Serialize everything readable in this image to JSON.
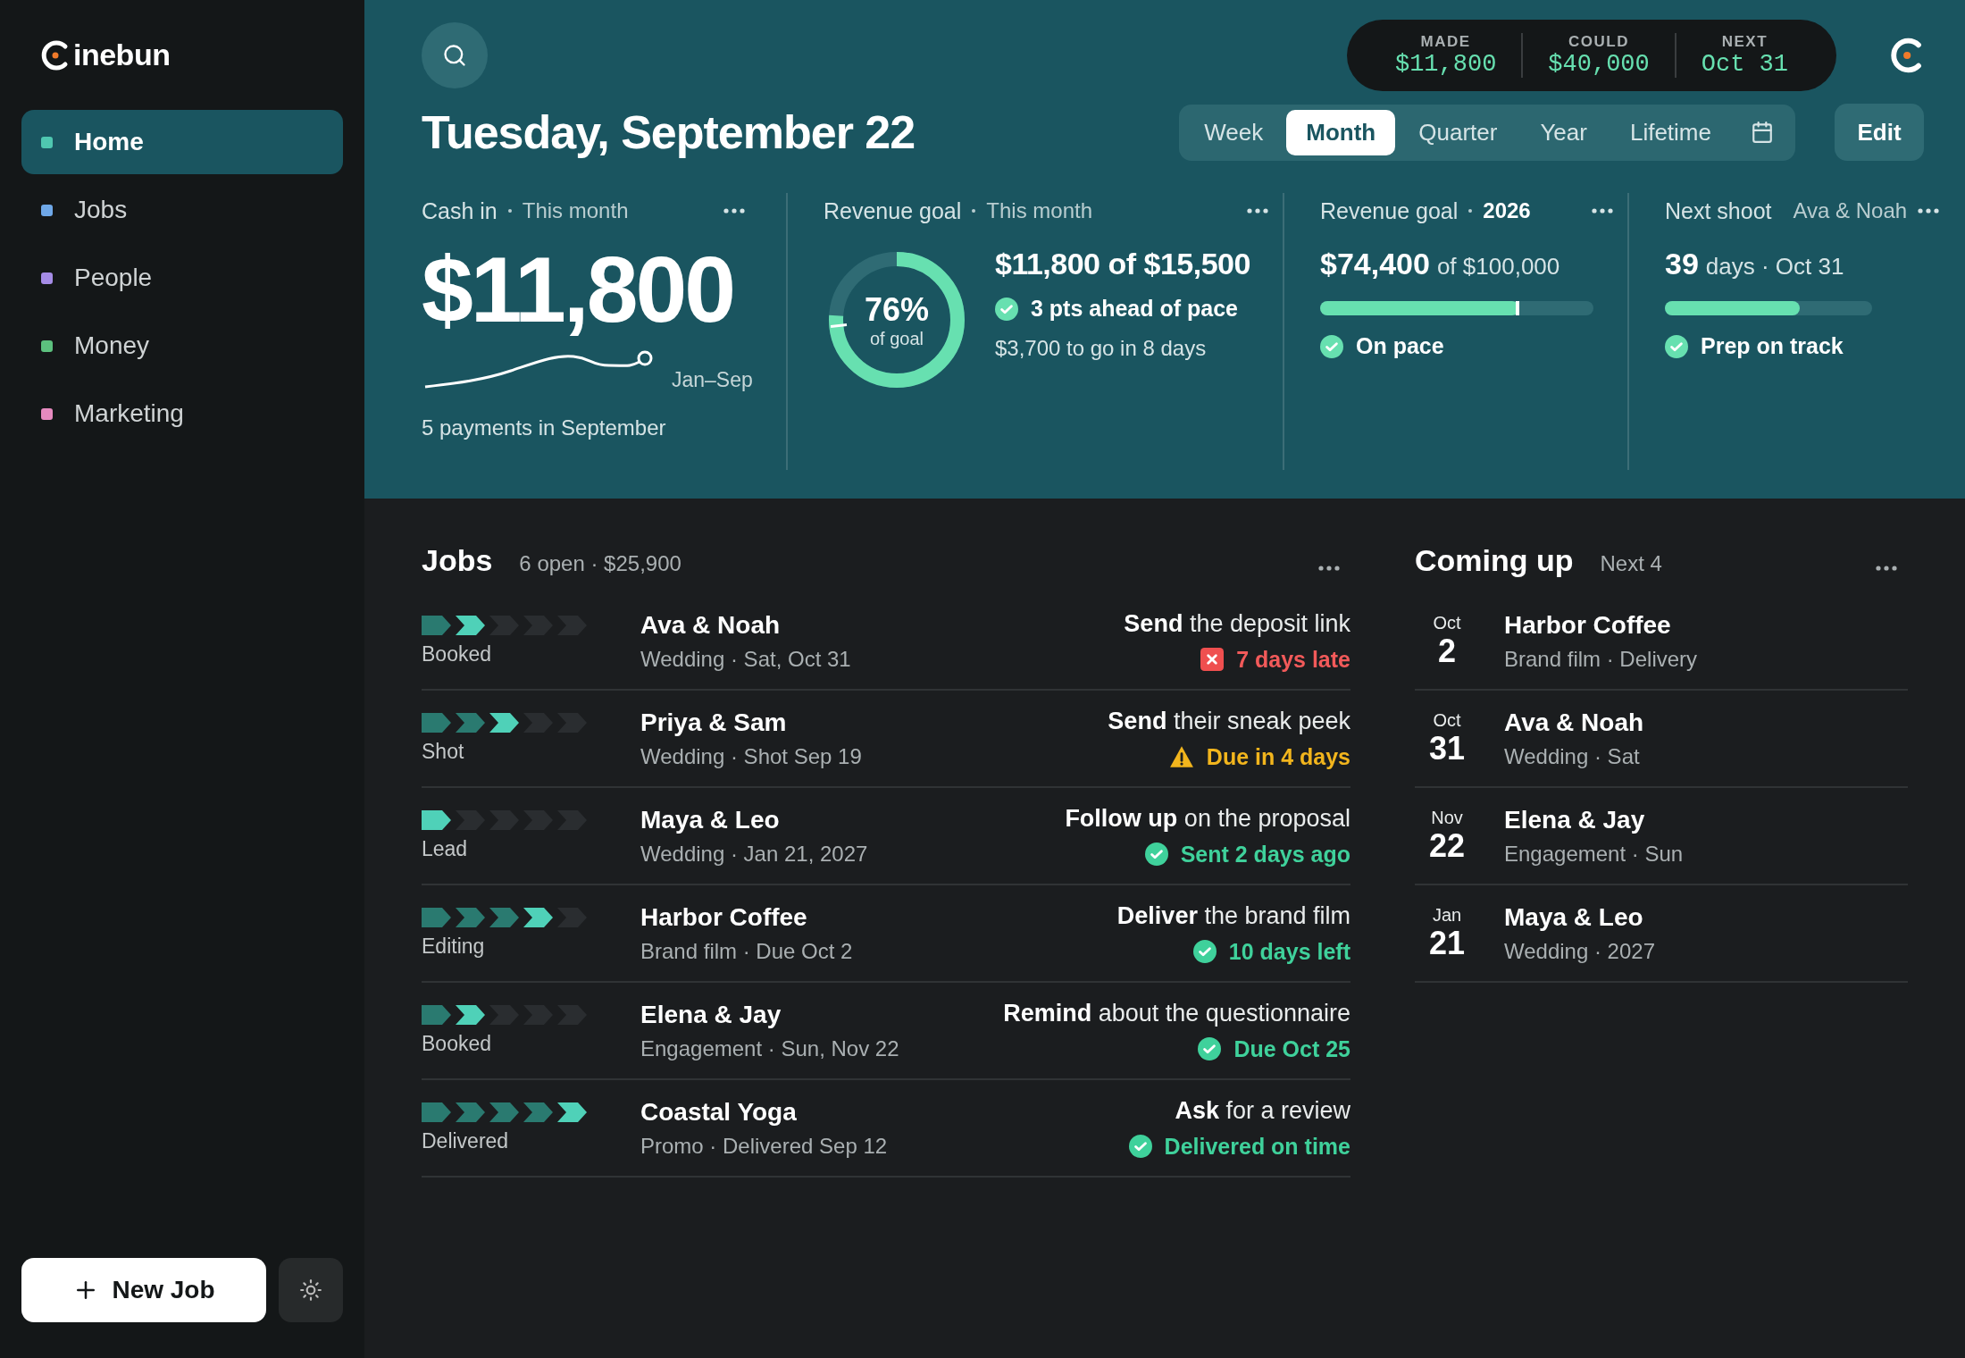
{
  "brand": {
    "name": "inebun"
  },
  "nav": [
    {
      "label": "Home",
      "selected": true,
      "color": "#4fc7b0"
    },
    {
      "label": "Jobs",
      "selected": false,
      "color": "#6fa8e8"
    },
    {
      "label": "People",
      "selected": false,
      "color": "#a58ce6"
    },
    {
      "label": "Money",
      "selected": false,
      "color": "#5cc17e"
    },
    {
      "label": "Marketing",
      "selected": false,
      "color": "#e68abf"
    }
  ],
  "new_job_button": "New Job",
  "summary": [
    {
      "label": "MADE",
      "value": "$11,800"
    },
    {
      "label": "COULD",
      "value": "$40,000"
    },
    {
      "label": "NEXT",
      "value": "Oct 31"
    }
  ],
  "title": "Tuesday, September 22",
  "ranges": [
    {
      "label": "Week",
      "selected": false
    },
    {
      "label": "Month",
      "selected": true
    },
    {
      "label": "Quarter",
      "selected": false
    },
    {
      "label": "Year",
      "selected": false
    },
    {
      "label": "Lifetime",
      "selected": false
    }
  ],
  "edit_button": "Edit",
  "cards": [
    {
      "kind": "cash",
      "label": "Cash in",
      "sub": "This month",
      "sub_strong": false,
      "amount": "$11,800",
      "caption": "Jan–Sep",
      "footer": "5 payments in September"
    },
    {
      "kind": "ring",
      "label": "Revenue goal",
      "sub": "This month",
      "sub_strong": false,
      "ring_value": "76%",
      "ring_label": "of goal",
      "headline": "$11,800 of $15,500",
      "status": "3 pts ahead of pace",
      "note": "$3,700 to go in 8 days"
    },
    {
      "kind": "bar",
      "label": "Revenue goal",
      "sub": "2026",
      "sub_strong": true,
      "value": "$74,400",
      "suffix": "of $100,000",
      "level": 0.73,
      "status": "On pace"
    },
    {
      "kind": "bar",
      "label": "Next shoot",
      "sub": "Ava & Noah",
      "sub_strong": false,
      "value": "39",
      "suffix": "days · Oct 31",
      "level": 0.65,
      "status": "Prep on track"
    }
  ],
  "jobs": {
    "title": "Jobs",
    "summary": "6 open · $25,900",
    "rows": [
      {
        "steps": [
          {
            "done": true
          },
          {
            "done": true
          },
          {
            "done": false
          },
          {
            "done": false
          },
          {
            "done": false
          }
        ],
        "stage": "Booked",
        "name": "Ava & Noah",
        "meta": "Wedding · Sat, Oct 31",
        "action": "**Send** the deposit link",
        "status": {
          "kind": "late",
          "text": "7 days late"
        }
      },
      {
        "steps": [
          {
            "done": true
          },
          {
            "done": true
          },
          {
            "done": true
          },
          {
            "done": false
          },
          {
            "done": false
          }
        ],
        "stage": "Shot",
        "name": "Priya & Sam",
        "meta": "Wedding · Shot Sep 19",
        "action": "**Send** their sneak peek",
        "status": {
          "kind": "warning",
          "text": "Due in 4 days"
        }
      },
      {
        "steps": [
          {
            "done": true
          },
          {
            "done": false
          },
          {
            "done": false
          },
          {
            "done": false
          },
          {
            "done": false
          }
        ],
        "stage": "Lead",
        "name": "Maya & Leo",
        "meta": "Wedding · Jan 21, 2027",
        "action": "**Follow up** on the proposal",
        "status": {
          "kind": "ok",
          "text": "Sent 2 days ago"
        }
      },
      {
        "steps": [
          {
            "done": true
          },
          {
            "done": true
          },
          {
            "done": true
          },
          {
            "done": true
          },
          {
            "done": false
          }
        ],
        "stage": "Editing",
        "name": "Harbor Coffee",
        "meta": "Brand film · Due Oct 2",
        "action": "**Deliver** the brand film",
        "status": {
          "kind": "ok",
          "text": "10 days left"
        }
      },
      {
        "steps": [
          {
            "done": true
          },
          {
            "done": true
          },
          {
            "done": false
          },
          {
            "done": false
          },
          {
            "done": false
          }
        ],
        "stage": "Booked",
        "name": "Elena & Jay",
        "meta": "Engagement · Sun, Nov 22",
        "action": "**Remind** about the questionnaire",
        "status": {
          "kind": "ok",
          "text": "Due Oct 25"
        }
      },
      {
        "steps": [
          {
            "done": true
          },
          {
            "done": true
          },
          {
            "done": true
          },
          {
            "done": true
          },
          {
            "done": true
          }
        ],
        "stage": "Delivered",
        "name": "Coastal Yoga",
        "meta": "Promo · Delivered Sep 12",
        "action": "**Ask** for a review",
        "status": {
          "kind": "ok",
          "text": "Delivered on time"
        }
      }
    ]
  },
  "upcoming": {
    "title": "Coming up",
    "summary": "Next 4",
    "rows": [
      {
        "month": "Oct",
        "day": "2",
        "name": "Harbor Coffee",
        "meta": "Brand film · Delivery"
      },
      {
        "month": "Oct",
        "day": "31",
        "name": "Ava & Noah",
        "meta": "Wedding · Sat"
      },
      {
        "month": "Nov",
        "day": "22",
        "name": "Elena & Jay",
        "meta": "Engagement · Sun"
      },
      {
        "month": "Jan",
        "day": "21",
        "name": "Maya & Leo",
        "meta": "Wedding · 2027"
      }
    ]
  }
}
